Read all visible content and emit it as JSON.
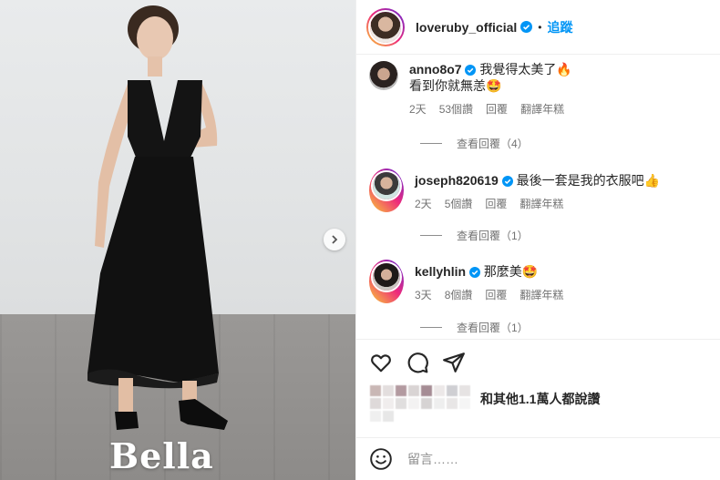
{
  "post": {
    "brand_logo": "Bella",
    "colors": {
      "accent": "#0095f6",
      "verified": "#0095f6"
    }
  },
  "header": {
    "username": "loveruby_official",
    "separator": "•",
    "follow_label": "追蹤"
  },
  "comments": [
    {
      "username": "anno8o7",
      "text_line1": "我覺得太美了🔥",
      "text_line2": "看到你就無恙🤩",
      "time": "2天",
      "likes": "53個讚",
      "reply": "回覆",
      "translate": "翻譯年糕",
      "view_replies": "查看回覆（4）"
    },
    {
      "username": "joseph820619",
      "text_line1": "最後一套是我的衣服吧👍",
      "time": "2天",
      "likes": "5個讚",
      "reply": "回覆",
      "translate": "翻譯年糕",
      "view_replies": "查看回覆（1）"
    },
    {
      "username": "kellyhlin",
      "text_line1": "那麼美🤩",
      "time": "3天",
      "likes": "8個讚",
      "reply": "回覆",
      "translate": "翻譯年糕",
      "view_replies": "查看回覆（1）"
    }
  ],
  "likes": {
    "text": "和其他1.1萬人都說讚"
  },
  "composer": {
    "placeholder": "留言……"
  },
  "icons": [
    "heart-icon",
    "comment-icon",
    "share-icon",
    "emoji-icon",
    "chevron-right-icon",
    "verified-icon"
  ]
}
